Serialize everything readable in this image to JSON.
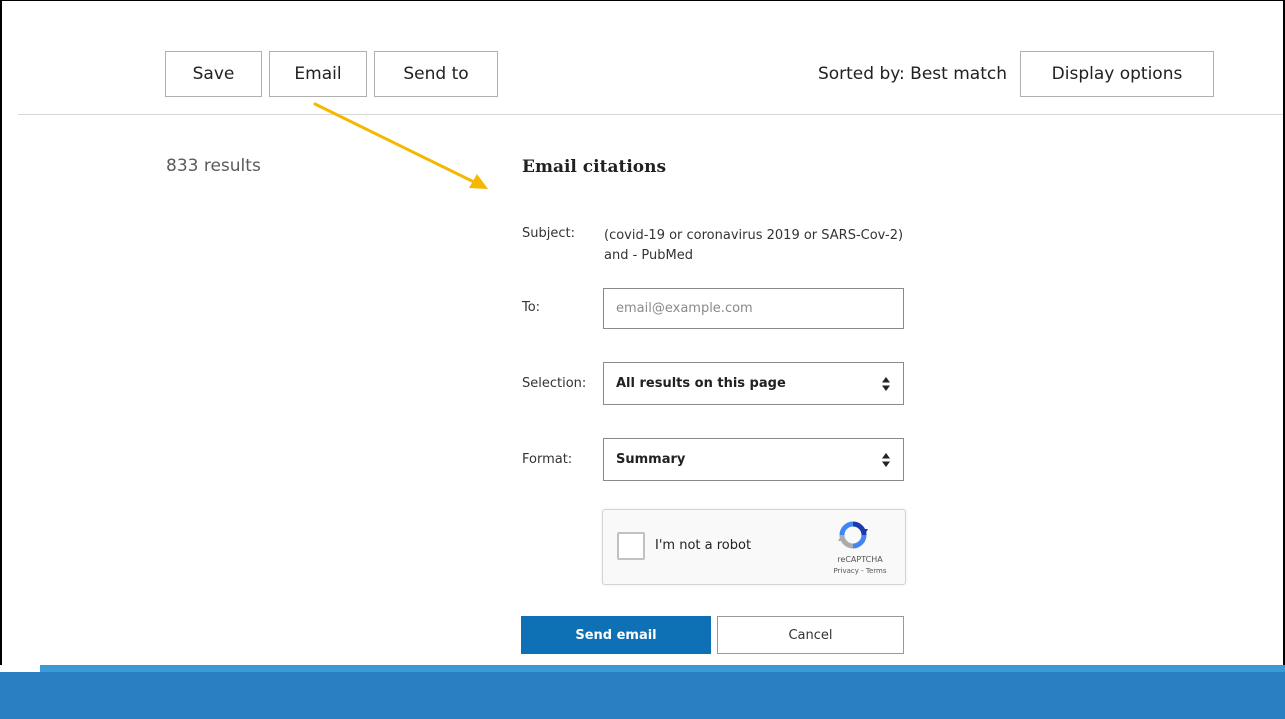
{
  "toolbar": {
    "save_label": "Save",
    "email_label": "Email",
    "send_to_label": "Send to",
    "sorted_label": "Sorted by: Best match",
    "display_options_label": "Display options"
  },
  "results": {
    "count_text": "833 results"
  },
  "email_panel": {
    "title": "Email citations",
    "subject_label": "Subject:",
    "subject_value": "(covid-19 or coronavirus 2019 or SARS-Cov-2) and - PubMed",
    "to_label": "To:",
    "to_placeholder": "email@example.com",
    "selection_label": "Selection:",
    "selection_value": "All results on this page",
    "format_label": "Format:",
    "format_value": "Summary",
    "captcha": {
      "label": "I'm not a robot",
      "brand": "reCAPTCHA",
      "links": "Privacy - Terms"
    },
    "send_label": "Send email",
    "cancel_label": "Cancel"
  },
  "colors": {
    "primary_button": "#0e70b5",
    "annotation_arrow": "#f5b800",
    "footer_bar": "#2a7fc2"
  },
  "icons": [
    "up-down-caret-icon",
    "recaptcha-logo-icon",
    "annotation-arrow"
  ]
}
